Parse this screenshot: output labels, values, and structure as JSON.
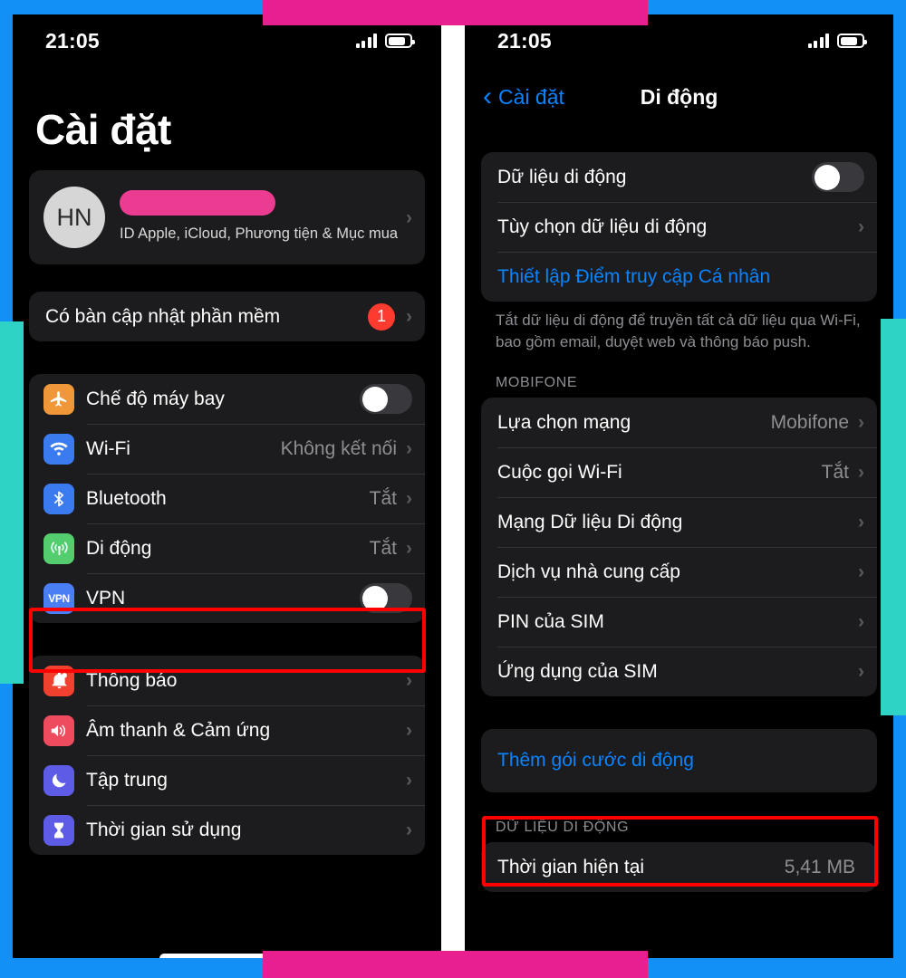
{
  "colors": {
    "frame_blue": "#1290f5",
    "frame_pink": "#e81f8e",
    "frame_teal": "#2ed3c6",
    "highlight_red": "#ff0000",
    "ios_blue": "#0a84ff",
    "badge_red": "#ff3b30"
  },
  "left_phone": {
    "status_bar": {
      "time": "21:05",
      "signal_icon": "signal-bars-icon",
      "battery_icon": "battery-icon"
    },
    "page_title": "Cài đặt",
    "account": {
      "avatar_initials": "HN",
      "name_redacted": true,
      "subtitle": "ID Apple, iCloud, Phương tiện & Mục mua",
      "chevron": "›"
    },
    "update_row": {
      "label": "Có bàn cập nhật phần mềm",
      "badge": "1",
      "chevron": "›"
    },
    "connectivity": [
      {
        "label": "Chế độ máy bay",
        "icon": "airplane-icon",
        "control": "toggle",
        "toggle_on": false
      },
      {
        "label": "Wi-Fi",
        "icon": "wifi-icon",
        "control": "value",
        "value": "Không kết nối",
        "chevron": "›"
      },
      {
        "label": "Bluetooth",
        "icon": "bluetooth-icon",
        "control": "value",
        "value": "Tắt",
        "chevron": "›"
      },
      {
        "label": "Di động",
        "icon": "cellular-icon",
        "control": "value",
        "value": "Tắt",
        "chevron": "›",
        "highlighted": true
      },
      {
        "label": "VPN",
        "icon": "vpn-icon",
        "control": "toggle",
        "toggle_on": false
      }
    ],
    "system": [
      {
        "label": "Thông báo",
        "icon": "bell-icon",
        "chevron": "›"
      },
      {
        "label": "Âm thanh & Cảm ứng",
        "icon": "speaker-icon",
        "chevron": "›"
      },
      {
        "label": "Tập trung",
        "icon": "moon-icon",
        "chevron": "›"
      },
      {
        "label": "Thời gian sử dụng",
        "icon": "hourglass-icon",
        "chevron": "›"
      }
    ]
  },
  "right_phone": {
    "status_bar": {
      "time": "21:05",
      "signal_icon": "signal-bars-icon",
      "battery_icon": "battery-icon"
    },
    "nav": {
      "back_icon": "chevron-left-icon",
      "back_label": "Cài đặt",
      "title": "Di động"
    },
    "top_group": [
      {
        "label": "Dữ liệu di động",
        "control": "toggle",
        "toggle_on": false
      },
      {
        "label": "Tùy chọn dữ liệu di động",
        "control": "chevron",
        "chevron": "›"
      },
      {
        "label": "Thiết lập Điểm truy cập Cá nhân",
        "control": "link"
      }
    ],
    "top_footer": "Tắt dữ liệu di động để truyền tất cả dữ liệu qua Wi-Fi, bao gồm email, duyệt web và thông báo push.",
    "carrier_header": "MOBIFONE",
    "carrier_rows": [
      {
        "label": "Lựa chọn mạng",
        "value": "Mobifone",
        "chevron": "›"
      },
      {
        "label": "Cuộc gọi Wi-Fi",
        "value": "Tắt",
        "chevron": "›"
      },
      {
        "label": "Mạng Dữ liệu Di động",
        "value": "",
        "chevron": "›"
      },
      {
        "label": "Dịch vụ nhà cung cấp",
        "value": "",
        "chevron": "›"
      },
      {
        "label": "PIN của SIM",
        "value": "",
        "chevron": "›"
      },
      {
        "label": "Ứng dụng của SIM",
        "value": "",
        "chevron": "›"
      }
    ],
    "add_plan": {
      "label": "Thêm gói cước di động",
      "highlighted": true
    },
    "data_header": "DỮ LIỆU DI ĐỘNG",
    "data_rows": [
      {
        "label": "Thời gian hiện tại",
        "value": "5,41 MB"
      }
    ]
  }
}
